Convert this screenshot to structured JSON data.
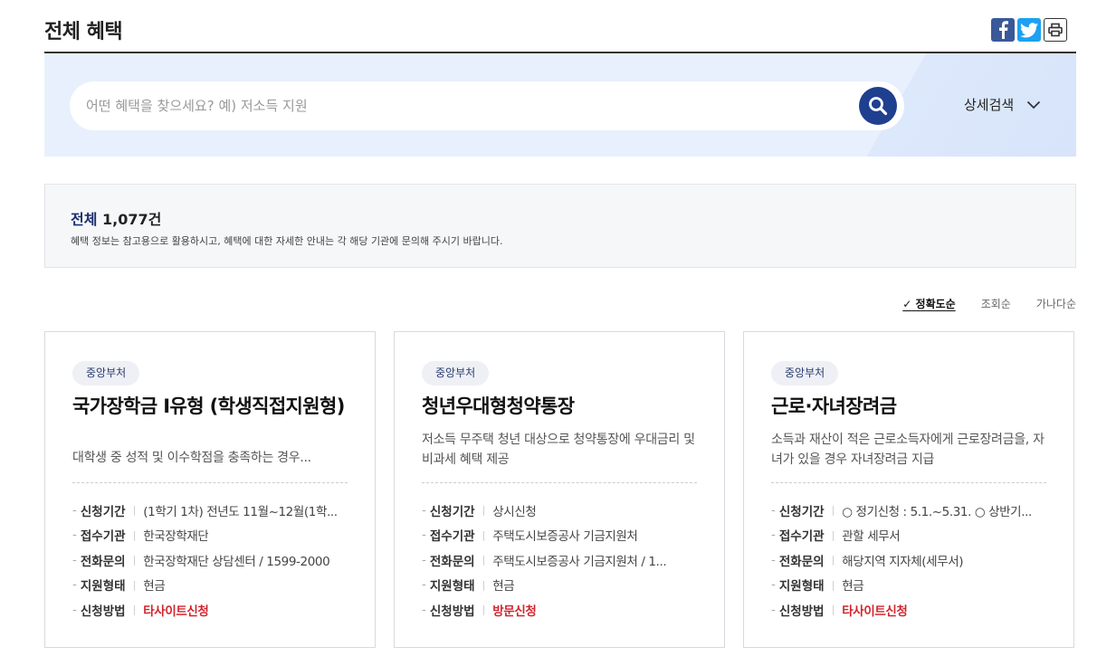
{
  "header": {
    "title": "전체 혜택"
  },
  "share": {
    "facebook": "facebook-icon",
    "twitter": "twitter-icon",
    "print": "print-icon"
  },
  "search": {
    "placeholder": "어떤 혜택을 찾으세요? 예) 저소득 지원",
    "value": "",
    "detail_label": "상세검색"
  },
  "summary": {
    "total_label": "전체",
    "total_count": "1,077건",
    "notice": "혜택 정보는 참고용으로 활용하시고, 혜택에 대한 자세한 안내는 각 해당 기관에 문의해 주시기 바랍니다."
  },
  "sort": {
    "check": "✓",
    "options": [
      "정확도순",
      "조회순",
      "가나다순"
    ],
    "active": "정확도순"
  },
  "cards": [
    {
      "badge": "중앙부처",
      "title": "국가장학금 Ⅰ유형 (학생직접지원형)",
      "desc": "대학생 중 성적 및 이수학점을 충족하는 경우...",
      "rows": [
        {
          "key": "신청기간",
          "value": "(1학기 1차) 전년도 11월~12월(1학..."
        },
        {
          "key": "접수기관",
          "value": "한국장학재단"
        },
        {
          "key": "전화문의",
          "value": "한국장학재단 상담센터 / 1599-2000"
        },
        {
          "key": "지원형태",
          "value": "현금"
        },
        {
          "key": "신청방법",
          "value": "타사이트신청"
        }
      ]
    },
    {
      "badge": "중앙부처",
      "title": "청년우대형청약통장",
      "desc": "저소득 무주택 청년 대상으로 청약통장에 우대금리 및 비과세 혜택 제공",
      "rows": [
        {
          "key": "신청기간",
          "value": "상시신청"
        },
        {
          "key": "접수기관",
          "value": "주택도시보증공사 기금지원처"
        },
        {
          "key": "전화문의",
          "value": "주택도시보증공사 기금지원처 / 1..."
        },
        {
          "key": "지원형태",
          "value": "현금"
        },
        {
          "key": "신청방법",
          "value": "방문신청"
        }
      ]
    },
    {
      "badge": "중앙부처",
      "title": "근로·자녀장려금",
      "desc": "소득과 재산이 적은 근로소득자에게 근로장려금을, 자녀가 있을 경우 자녀장려금 지급",
      "rows": [
        {
          "key": "신청기간",
          "value": "○ 정기신청 : 5.1.~5.31. ○ 상반기..."
        },
        {
          "key": "접수기관",
          "value": "관할 세무서"
        },
        {
          "key": "전화문의",
          "value": "해당지역 지자체(세무서)"
        },
        {
          "key": "지원형태",
          "value": "현금"
        },
        {
          "key": "신청방법",
          "value": "타사이트신청"
        }
      ]
    }
  ],
  "colors": {
    "accent": "#1f3f8f",
    "band": "#e8f0fd",
    "method": "#d0262e"
  }
}
